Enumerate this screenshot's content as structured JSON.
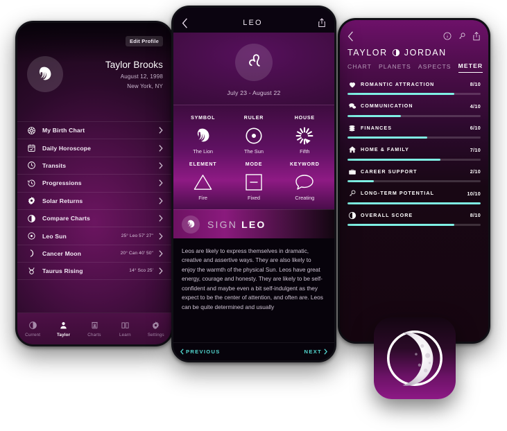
{
  "colors": {
    "accent_teal": "#7ff0e4",
    "accent_link": "#53d8d0",
    "magenta": "#8e1a84",
    "deep_purple": "#4a0d4b",
    "dark_bg": "#07030b"
  },
  "left_phone": {
    "edit_profile_label": "Edit Profile",
    "profile": {
      "name": "Taylor Brooks",
      "birthdate": "August 12, 1998",
      "location": "New York, NY",
      "avatar_icon": "lion-icon"
    },
    "menu": [
      {
        "icon": "birth-chart-wheel-icon",
        "label": "My Birth Chart",
        "value": ""
      },
      {
        "icon": "calendar-check-icon",
        "label": "Daily Horoscope",
        "value": ""
      },
      {
        "icon": "clock-icon",
        "label": "Transits",
        "value": ""
      },
      {
        "icon": "clock-rewind-icon",
        "label": "Progressions",
        "value": ""
      },
      {
        "icon": "sun-gear-icon",
        "label": "Solar Returns",
        "value": ""
      },
      {
        "icon": "half-circle-icon",
        "label": "Compare Charts",
        "value": ""
      },
      {
        "icon": "sun-icon",
        "label": "Leo Sun",
        "value": "25° Leo 57' 27\""
      },
      {
        "icon": "moon-icon",
        "label": "Cancer Moon",
        "value": "20° Can 40' 50\""
      },
      {
        "icon": "taurus-icon",
        "label": "Taurus Rising",
        "value": "14° Sco 25'"
      }
    ],
    "tabs": [
      {
        "icon": "moon-phase-icon",
        "label": "Current",
        "active": false
      },
      {
        "icon": "person-icon",
        "label": "Taylor",
        "active": true
      },
      {
        "icon": "charts-icon",
        "label": "Charts",
        "active": false
      },
      {
        "icon": "book-icon",
        "label": "Learn",
        "active": false
      },
      {
        "icon": "gear-icon",
        "label": "Settings",
        "active": false
      }
    ]
  },
  "mid_phone": {
    "nav": {
      "back_icon": "chevron-left-icon",
      "title": "LEO",
      "share_icon": "share-icon"
    },
    "hero": {
      "glyph_icon": "leo-glyph-icon",
      "dates": "July 23 - August 22"
    },
    "attributes": [
      {
        "label": "SYMBOL",
        "icon": "lion-icon",
        "value": "The Lion"
      },
      {
        "label": "RULER",
        "icon": "sun-icon",
        "value": "The Sun"
      },
      {
        "label": "HOUSE",
        "icon": "house-wheel-icon",
        "value": "Fifth"
      },
      {
        "label": "ELEMENT",
        "icon": "fire-triangle-icon",
        "value": "Fire"
      },
      {
        "label": "MODE",
        "icon": "fixed-square-icon",
        "value": "Fixed"
      },
      {
        "label": "KEYWORD",
        "icon": "speech-bubble-icon",
        "value": "Creating"
      }
    ],
    "banner": {
      "icon": "lion-icon",
      "prefix": "SIGN",
      "name": "LEO"
    },
    "description": "Leos are likely to express themselves in dramatic, creative and assertive ways. They are also likely to enjoy the warmth of the physical Sun. Leos have great energy, courage and honesty. They are likely to be self-confident and maybe even a bit self-indulgent as they expect to be the center of attention, and often are. Leos can be quite determined and usually",
    "footer": {
      "previous": "PREVIOUS",
      "next": "NEXT"
    }
  },
  "right_phone": {
    "nav": {
      "back_icon": "chevron-left-icon",
      "icons": [
        "info-icon",
        "key-icon",
        "share-icon"
      ]
    },
    "title_left": "TAYLOR",
    "title_icon": "half-circle-icon",
    "title_right": "JORDAN",
    "tabs": [
      {
        "label": "CHART",
        "active": false
      },
      {
        "label": "PLANETS",
        "active": false
      },
      {
        "label": "ASPECTS",
        "active": false
      },
      {
        "label": "METER",
        "active": true
      }
    ],
    "meters": [
      {
        "icon": "heart-icon",
        "label": "ROMANTIC ATTRACTION",
        "score": "8/10",
        "value": 8,
        "max": 10
      },
      {
        "icon": "chat-bubbles-icon",
        "label": "COMMUNICATION",
        "score": "4/10",
        "value": 4,
        "max": 10
      },
      {
        "icon": "coins-icon",
        "label": "FINANCES",
        "score": "6/10",
        "value": 6,
        "max": 10
      },
      {
        "icon": "home-icon",
        "label": "HOME & FAMILY",
        "score": "7/10",
        "value": 7,
        "max": 10
      },
      {
        "icon": "briefcase-icon",
        "label": "CAREER SUPPORT",
        "score": "2/10",
        "value": 2,
        "max": 10
      },
      {
        "icon": "key-icon",
        "label": "LONG-TERM POTENTIAL",
        "score": "10/10",
        "value": 10,
        "max": 10
      },
      {
        "icon": "half-circle-icon",
        "label": "OVERALL SCORE",
        "score": "8/10",
        "value": 8,
        "max": 10
      }
    ]
  },
  "app_icon": {
    "name": "crescent-moon-app-icon"
  }
}
